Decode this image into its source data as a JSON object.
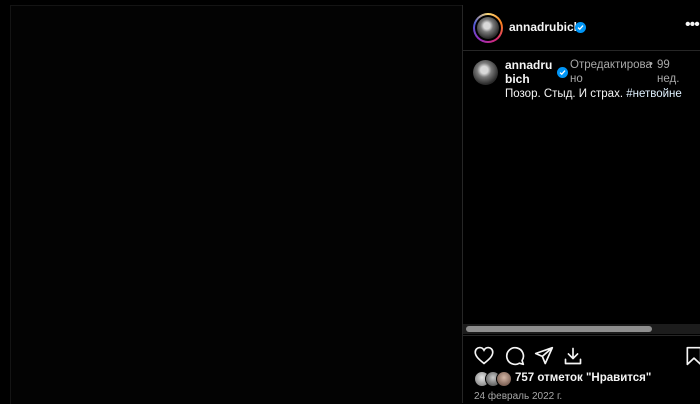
{
  "post": {
    "username": "annadrubich",
    "verified": true
  },
  "caption": {
    "username": "annadrubich",
    "edited_label": "Отредактировано",
    "time": "99 нед.",
    "text_plain": "Позор. Стыд. И страх. ",
    "hashtag": "#нетвойне"
  },
  "actions": {
    "icons": [
      "heart-icon",
      "comment-icon",
      "share-icon",
      "download-icon",
      "bookmark-icon"
    ]
  },
  "likes": {
    "text": "757 отметок \"Нравится\""
  },
  "date": "24 февраль 2022 г.",
  "colors": {
    "background": "#000000",
    "verified": "#0095f6",
    "muted_text": "#a8a8a8"
  }
}
